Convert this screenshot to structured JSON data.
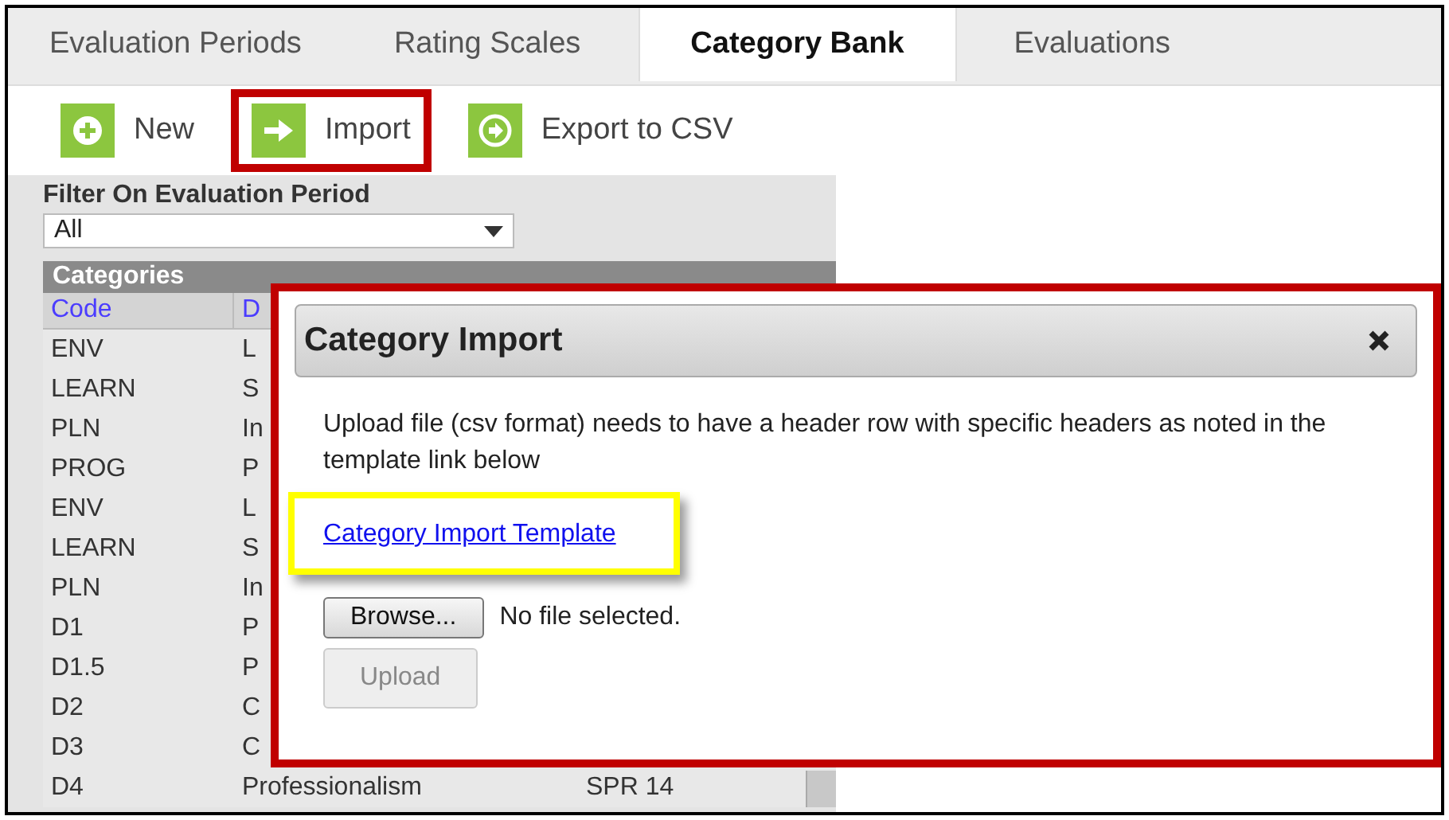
{
  "tabs": [
    {
      "label": "Evaluation Periods",
      "selected": false
    },
    {
      "label": "Rating Scales",
      "selected": false
    },
    {
      "label": "Category Bank",
      "selected": true
    },
    {
      "label": "Evaluations",
      "selected": false
    }
  ],
  "toolbar": [
    {
      "label": "New",
      "kind": "plus",
      "highlighted": false
    },
    {
      "label": "Import",
      "kind": "arrow",
      "highlighted": true
    },
    {
      "label": "Export to CSV",
      "kind": "export",
      "highlighted": false
    }
  ],
  "filter": {
    "label": "Filter On Evaluation Period",
    "value": "All"
  },
  "categories": {
    "title": "Categories",
    "columns": [
      "Code",
      "D"
    ],
    "rows": [
      [
        "ENV",
        "L"
      ],
      [
        "LEARN",
        "S"
      ],
      [
        "PLN",
        "In"
      ],
      [
        "PROG",
        "P"
      ],
      [
        "ENV",
        "L"
      ],
      [
        "LEARN",
        "S"
      ],
      [
        "PLN",
        "In"
      ],
      [
        "D1",
        "P"
      ],
      [
        "D1.5",
        "P"
      ],
      [
        "D2",
        "C"
      ],
      [
        "D3",
        "C"
      ],
      [
        "D4",
        "Professionalism",
        "SPR 14"
      ]
    ]
  },
  "dialog": {
    "title": "Category Import",
    "highlighted": true,
    "message": "Upload file (csv format) needs to have a header row with specific headers as noted in the template link below",
    "link": {
      "text": "Category Import Template",
      "highlighted": true
    },
    "browse_button": "Browse...",
    "file_status": "No file selected.",
    "upload_button": {
      "label": "Upload",
      "disabled": true
    }
  }
}
